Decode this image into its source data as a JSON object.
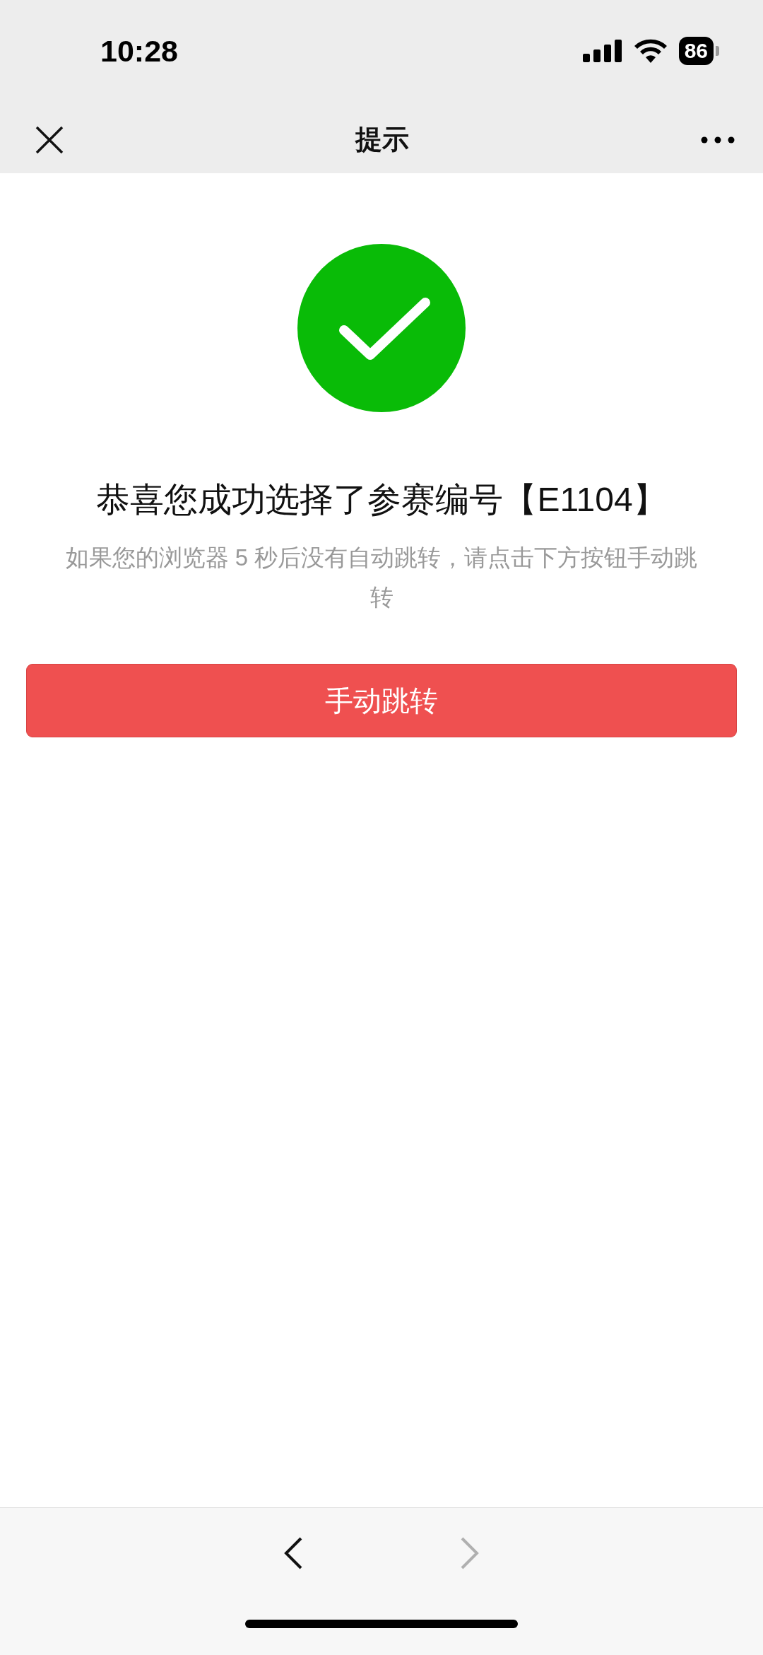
{
  "status_bar": {
    "time": "10:28",
    "battery": "86"
  },
  "nav": {
    "title": "提示"
  },
  "result": {
    "title": "恭喜您成功选择了参赛编号【E1104】",
    "message": "如果您的浏览器 5 秒后没有自动跳转，请点击下方按钮手动跳转",
    "button": "手动跳转"
  },
  "toolbar": {
    "back_disabled": false,
    "forward_disabled": true
  }
}
